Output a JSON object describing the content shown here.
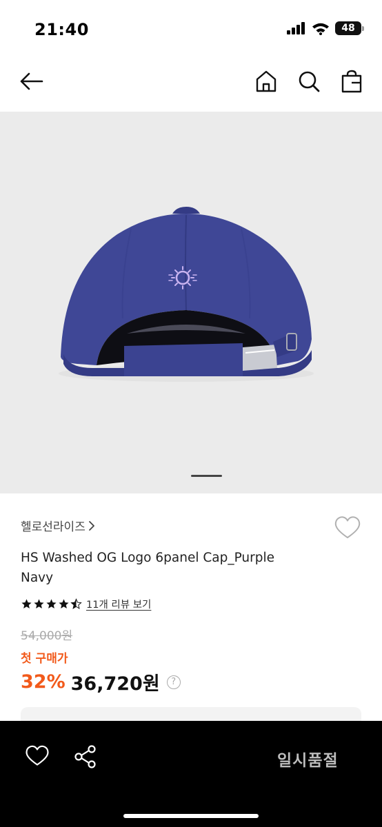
{
  "status": {
    "time": "21:40",
    "battery": "48"
  },
  "product": {
    "brand": "헬로선라이즈",
    "title": "HS Washed OG Logo 6panel Cap_Purple Navy",
    "rating": 4.5,
    "review_link": "11개 리뷰 보기",
    "original_price": "54,000원",
    "price_label": "첫 구매가",
    "discount": "32%",
    "sale_price": "36,720원",
    "help_glyph": "?",
    "image_index": 1,
    "image_count": 1
  },
  "bottom_bar": {
    "soldout_label": "일시품절"
  },
  "icons": [
    "back-arrow-icon",
    "home-icon",
    "search-icon",
    "shopping-bag-icon",
    "heart-icon",
    "share-icon",
    "help-icon",
    "chevron-right-icon",
    "star-icon"
  ],
  "colors": {
    "accent": "#f25a1b",
    "bottom_bar": "#000000",
    "image_bg": "#ebebeb",
    "cap": "#3f4796",
    "logo": "#c9b3f0"
  }
}
